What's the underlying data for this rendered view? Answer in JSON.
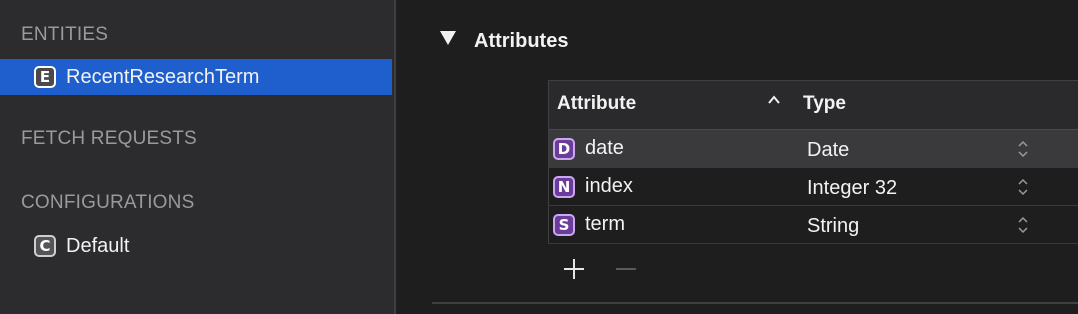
{
  "sidebar": {
    "entities_header": "ENTITIES",
    "entities": [
      {
        "badge": "E",
        "label": "RecentResearchTerm",
        "selected": true
      }
    ],
    "fetch_requests_header": "FETCH REQUESTS",
    "configurations_header": "CONFIGURATIONS",
    "configurations": [
      {
        "badge": "C",
        "label": "Default"
      }
    ]
  },
  "main": {
    "section_title": "Attributes",
    "table": {
      "columns": {
        "attribute": "Attribute",
        "type": "Type"
      },
      "rows": [
        {
          "badge": "D",
          "name": "date",
          "type": "Date"
        },
        {
          "badge": "N",
          "name": "index",
          "type": "Integer 32"
        },
        {
          "badge": "S",
          "name": "term",
          "type": "String"
        }
      ]
    }
  },
  "colors": {
    "selection": "#1f5fcd",
    "attribute_badge": "#6a3d9a",
    "background": "#1e1e1f",
    "sidebar": "#2c2c2e"
  },
  "icons": [
    "disclosure-triangle-icon",
    "sort-ascending-icon",
    "stepper-icon",
    "plus-icon",
    "minus-icon"
  ]
}
